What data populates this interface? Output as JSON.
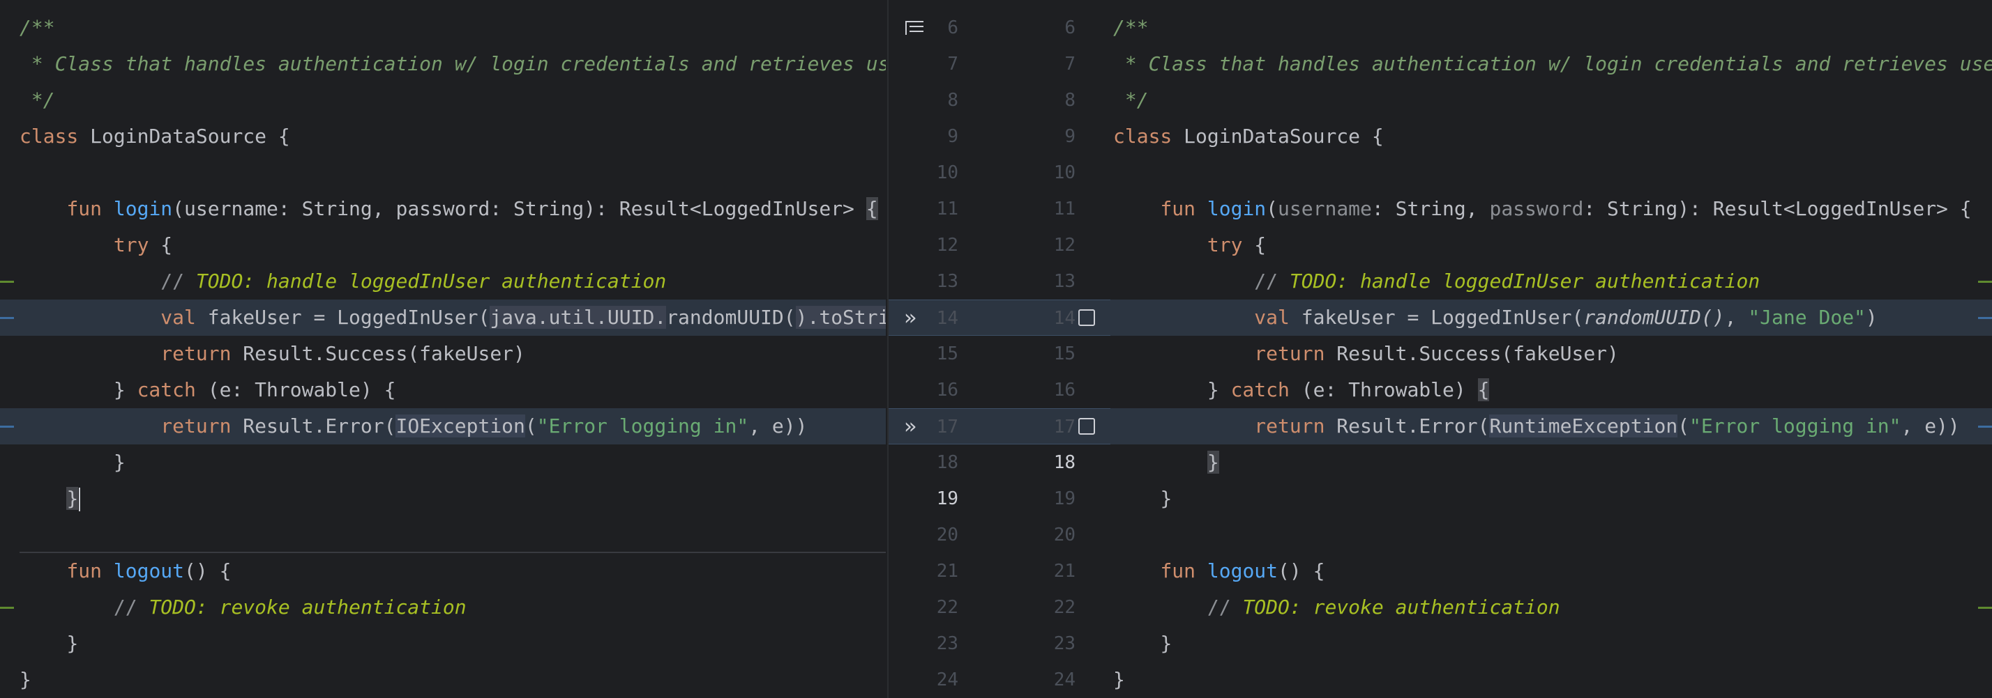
{
  "colors": {
    "background": "#1e1f22",
    "changed_line": "#2c3541",
    "keyword": "#cf8e6d",
    "function": "#56a8f5",
    "string": "#6aab73",
    "todo": "#a8c023"
  },
  "left": {
    "doc_open": "/**",
    "doc_line": " * Class that handles authentication w/ login credentials and retrieves us",
    "doc_close": " */",
    "class_kw": "class",
    "class_name": " LoginDataSource {",
    "fun_kw": "fun",
    "login_fn": "login",
    "login_sig": "(username: String, password: String): Result<LoggedInUser> ",
    "open_brace": "{",
    "try_kw": "try",
    "try_brace": " {",
    "todo_slash": "// ",
    "todo_text": "TODO: handle loggedInUser authentication",
    "val_kw": "val",
    "fake_user_pre": " fakeUser = LoggedInUser(",
    "uuid_pkg": "java.util.UUID.",
    "uuid_fn": "randomUUID(",
    "uuid_close": ")",
    "to_string": ".toStri",
    "return_kw": "return",
    "success": " Result.Success(fakeUser)",
    "catch_open": "} ",
    "catch_kw": "catch",
    "catch_rest": " (e: Throwable) {",
    "error_pre": " Result.Error(",
    "exception": "IOException",
    "error_msg": "\"Error logging in\"",
    "error_post": ", e))",
    "close_brace": "}",
    "logout_fn": "logout",
    "logout_rest": "() {",
    "revoke_slash": "// ",
    "revoke_text": "TODO: revoke authentication"
  },
  "gutter": {
    "rows": [
      {
        "left": "6",
        "right": "6"
      },
      {
        "left": "7",
        "right": "7"
      },
      {
        "left": "8",
        "right": "8"
      },
      {
        "left": "9",
        "right": "9"
      },
      {
        "left": "10",
        "right": "10"
      },
      {
        "left": "11",
        "right": "11"
      },
      {
        "left": "12",
        "right": "12"
      },
      {
        "left": "13",
        "right": "13"
      },
      {
        "left": "14",
        "right": "14"
      },
      {
        "left": "15",
        "right": "15"
      },
      {
        "left": "16",
        "right": "16"
      },
      {
        "left": "17",
        "right": "17"
      },
      {
        "left": "18",
        "right": "18"
      },
      {
        "left": "19",
        "right": "19"
      },
      {
        "left": "20",
        "right": "20"
      },
      {
        "left": "21",
        "right": "21"
      },
      {
        "left": "22",
        "right": "22"
      },
      {
        "left": "23",
        "right": "23"
      },
      {
        "left": "24",
        "right": "24"
      }
    ],
    "apply_arrow": "»"
  },
  "right": {
    "doc_open": "/**",
    "doc_line": " * Class that handles authentication w/ login credentials and retrieves use",
    "doc_close": " */",
    "class_kw": "class",
    "class_name": " LoginDataSource {",
    "fun_kw": "fun",
    "login_fn": "login",
    "paren_open": "(",
    "p_username": "username",
    "sig_mid": ": String, ",
    "p_password": "password",
    "sig_end": ": String): Result<LoggedInUser> {",
    "try_kw": "try",
    "try_brace": " {",
    "todo_slash": "// ",
    "todo_text": "TODO: handle loggedInUser authentication",
    "val_kw": "val",
    "fake_user_pre": " fakeUser = LoggedInUser(",
    "uuid_fn": "randomUUID()",
    "sep": ", ",
    "name_str": "\"Jane Doe\"",
    "fake_user_post": ")",
    "return_kw": "return",
    "success": " Result.Success(fakeUser)",
    "catch_open": "} ",
    "catch_kw": "catch",
    "catch_rest": " (e: Throwable) ",
    "catch_brace": "{",
    "error_pre": " Result.Error(",
    "exception": "RuntimeException",
    "error_msg": "\"Error logging in\"",
    "error_post": ", e))",
    "close_brace": "}",
    "logout_fn": "logout",
    "logout_rest": "() {",
    "revoke_slash": "// ",
    "revoke_text": "TODO: revoke authentication"
  }
}
